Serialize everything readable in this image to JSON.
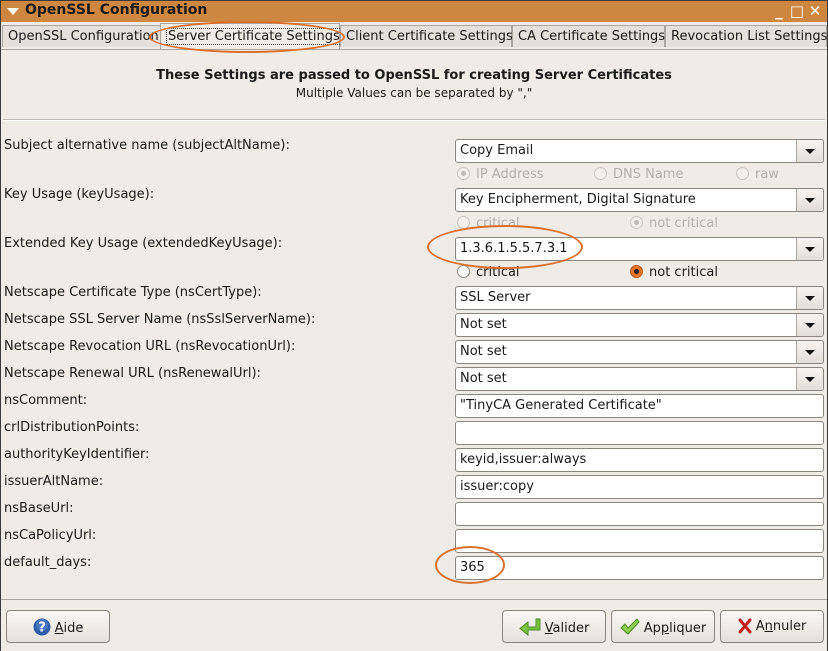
{
  "window": {
    "title": "OpenSSL Configuration",
    "controls": {
      "minimize": "_",
      "maximize": "□",
      "close": "✕"
    }
  },
  "tabs": [
    {
      "label": "OpenSSL Configuration",
      "active": false
    },
    {
      "label": "Server Certificate Settings",
      "active": true
    },
    {
      "label": "Client Certificate Settings",
      "active": false
    },
    {
      "label": "CA Certificate Settings",
      "active": false
    },
    {
      "label": "Revocation List Settings",
      "active": false
    }
  ],
  "header": {
    "title": "These Settings are passed to OpenSSL for creating Server Certificates",
    "subtitle": "Multiple Values can be separated by \",\""
  },
  "fields": {
    "subjectAltName": {
      "label": "Subject alternative name (subjectAltName):",
      "value": "Copy Email"
    },
    "subjectAltName_options": [
      {
        "label": "IP Address",
        "selected": true,
        "disabled": true
      },
      {
        "label": "DNS Name",
        "selected": false,
        "disabled": true
      },
      {
        "label": "raw",
        "selected": false,
        "disabled": true
      }
    ],
    "keyUsage": {
      "label": "Key Usage (keyUsage):",
      "value": "Key Encipherment, Digital Signature"
    },
    "keyUsage_options": [
      {
        "label": "critical",
        "selected": false,
        "disabled": true
      },
      {
        "label": "not critical",
        "selected": true,
        "disabled": true
      }
    ],
    "extendedKeyUsage": {
      "label": "Extended Key Usage (extendedKeyUsage):",
      "value": "1.3.6.1.5.5.7.3.1"
    },
    "extendedKeyUsage_options": [
      {
        "label": "critical",
        "selected": false,
        "disabled": false
      },
      {
        "label": "not critical",
        "selected": true,
        "disabled": false
      }
    ],
    "nsCertType": {
      "label": "Netscape Certificate Type (nsCertType):",
      "value": "SSL Server"
    },
    "nsSslServerName": {
      "label": "Netscape SSL Server Name (nsSslServerName):",
      "value": "Not set"
    },
    "nsRevocationUrl": {
      "label": "Netscape Revocation URL (nsRevocationUrl):",
      "value": "Not set"
    },
    "nsRenewalUrl": {
      "label": "Netscape Renewal URL (nsRenewalUrl):",
      "value": "Not set"
    },
    "nsComment": {
      "label": "nsComment:",
      "value": "\"TinyCA Generated Certificate\""
    },
    "crlDistributionPoints": {
      "label": "crlDistributionPoints:",
      "value": ""
    },
    "authorityKeyIdentifier": {
      "label": "authorityKeyIdentifier:",
      "value": "keyid,issuer:always"
    },
    "issuerAltName": {
      "label": "issuerAltName:",
      "value": "issuer:copy"
    },
    "nsBaseUrl": {
      "label": "nsBaseUrl:",
      "value": ""
    },
    "nsCaPolicyUrl": {
      "label": "nsCaPolicyUrl:",
      "value": ""
    },
    "default_days": {
      "label": "default_days:",
      "value": "365"
    }
  },
  "buttons": {
    "help": {
      "mnemonic": "A",
      "rest": "ide",
      "icon": "help-icon"
    },
    "ok": {
      "mnemonic": "V",
      "rest": "alider",
      "icon": "enter-arrow-icon"
    },
    "apply": {
      "pre": "Ap",
      "mnemonic": "p",
      "rest": "liquer",
      "icon": "checkmark-icon"
    },
    "cancel": {
      "pre": "A",
      "mnemonic": "n",
      "rest": "nuler",
      "icon": "x-icon"
    }
  },
  "colors": {
    "titlebar": "#cd8740",
    "annotation": "#d9702c",
    "background": "#efebe7"
  }
}
